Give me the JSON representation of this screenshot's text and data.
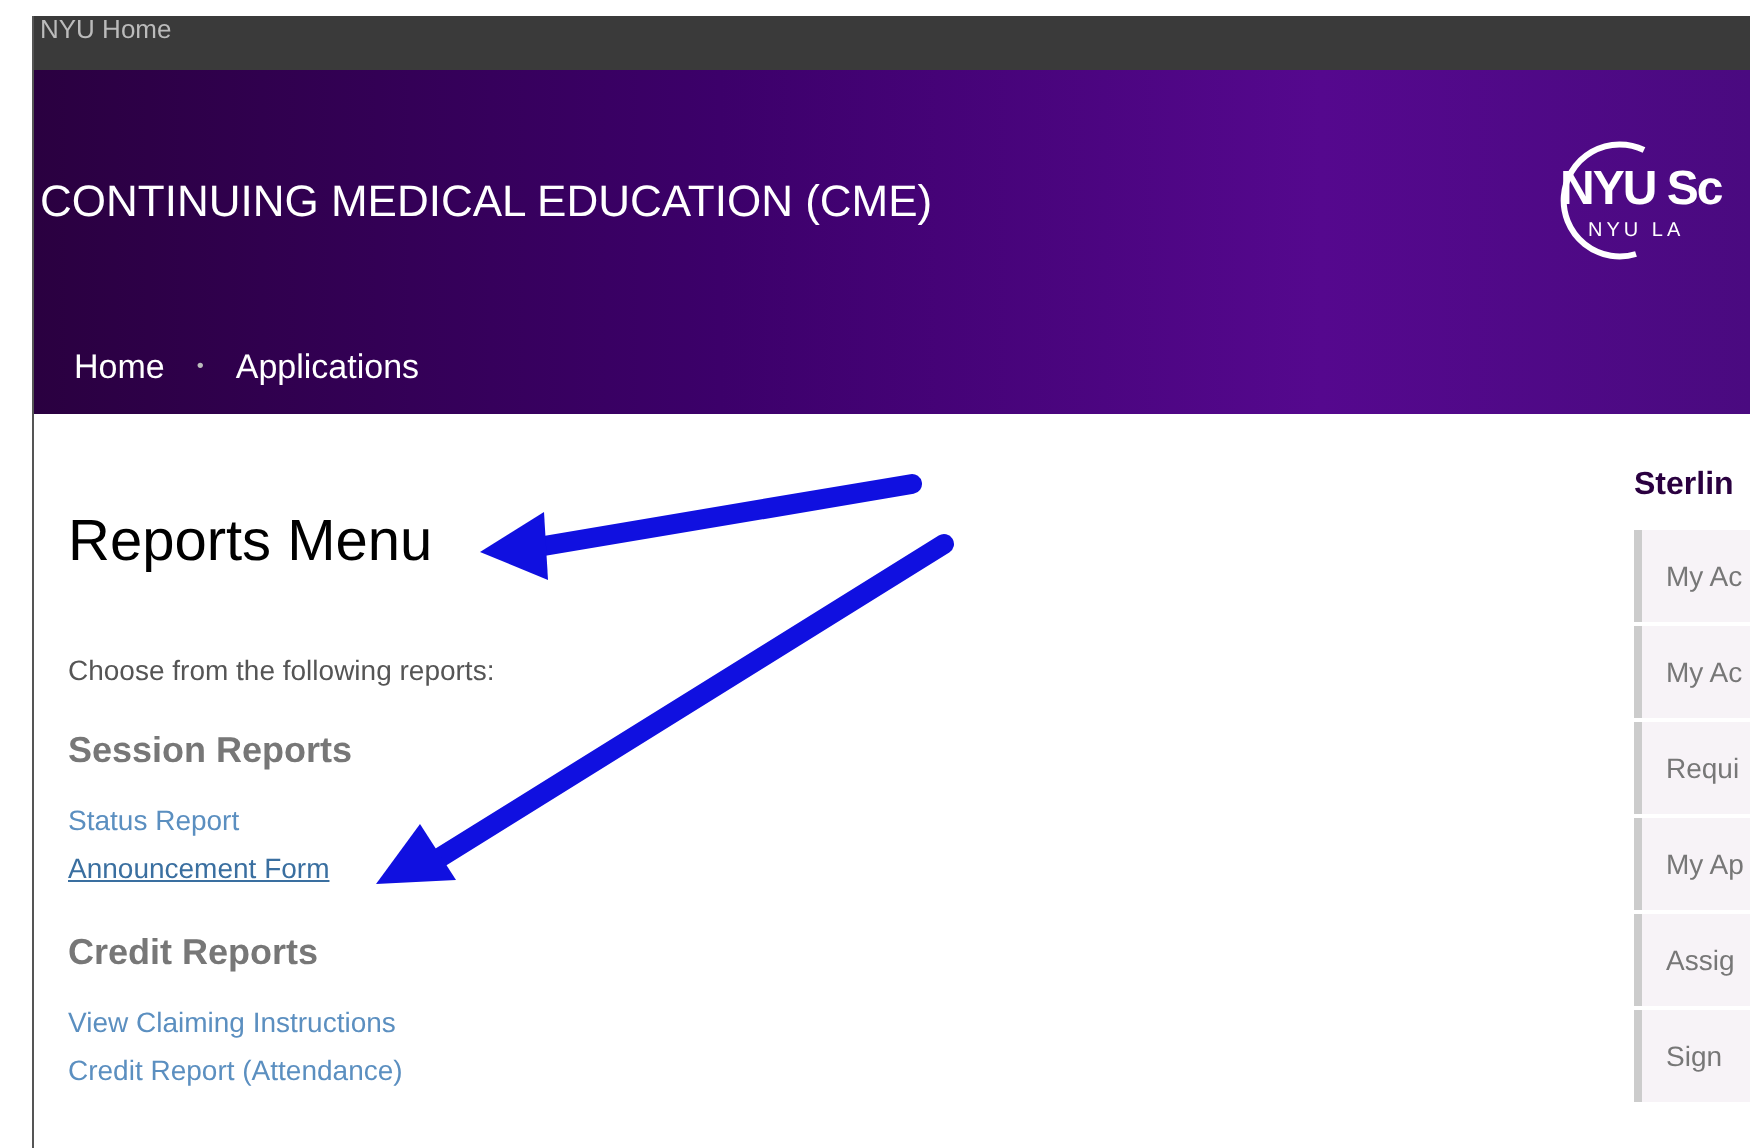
{
  "top_bar": {
    "link": "NYU Home"
  },
  "header": {
    "title": "CONTINUING MEDICAL EDUCATION (CME)",
    "logo_text": "NYU Sc",
    "logo_subtext": "NYU LA"
  },
  "nav": [
    {
      "label": "Home"
    },
    {
      "label": "Applications"
    }
  ],
  "nav_separator": "•",
  "main": {
    "heading": "Reports Menu",
    "intro": "Choose from the following reports:",
    "sections": [
      {
        "title": "Session Reports",
        "links": [
          {
            "label": "Status Report",
            "hovered": false
          },
          {
            "label": "Announcement Form",
            "hovered": true
          }
        ]
      },
      {
        "title": "Credit Reports",
        "links": [
          {
            "label": "View Claiming Instructions",
            "hovered": false
          },
          {
            "label": "Credit Report (Attendance)",
            "hovered": false
          }
        ]
      }
    ]
  },
  "sidebar": {
    "title": "Sterlin",
    "items": [
      {
        "label": "My Ac"
      },
      {
        "label": "My Ac"
      },
      {
        "label": "Requi"
      },
      {
        "label": "My Ap"
      },
      {
        "label": "Assig"
      },
      {
        "label": "Sign"
      }
    ]
  }
}
